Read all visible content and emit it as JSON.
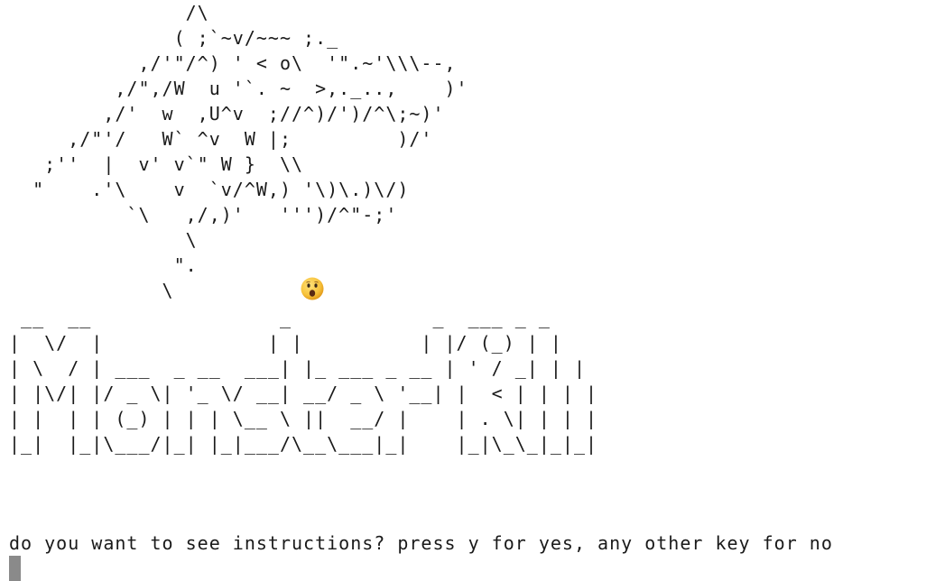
{
  "screen": {
    "dragon_art": "               /\\\n              ( ;`~v/~~~ ;._\n           ,/'\"/^) ' < o\\  '\".~'\\\\\\--,\n         ,/\",/W  u '`. ~  >,._..,    )'\n        ,/'  w  ,U^v  ;//^)/')/^\\;~)'\n     ,/\"'/   W` ^v  W |;         )/'\n   ;''  |  v' v`\" W }  \\\\\n  \"    .'\\    v  `v/^W,) '\\)\\.)\\/)\n          `\\   ,/,)'   ''')/^\"-;'\n               \\\n              \".\n             \\",
    "emoji_label": "astonished-face",
    "title_art": " __  __                _            _  ___ _ _\n|  \\/  |              | |          | |/ (_) | |\n| \\  / | ___  _ __  ___| |_ ___ _ __ | ' / _| | |\n| |\\/| |/ _ \\| '_ \\/ __| __/ _ \\ '__| |  < | | | |\n| |  | | (_) | | | \\__ \\ ||  __/ |    | . \\| | | |\n|_|  |_|\\___/|_| |_|___/\\__\\___|_|    |_|\\_\\_|_|_|",
    "prompt": "do you want to see instructions? press y for yes, any other key for no",
    "cursor_color": "#8a8a8a"
  }
}
